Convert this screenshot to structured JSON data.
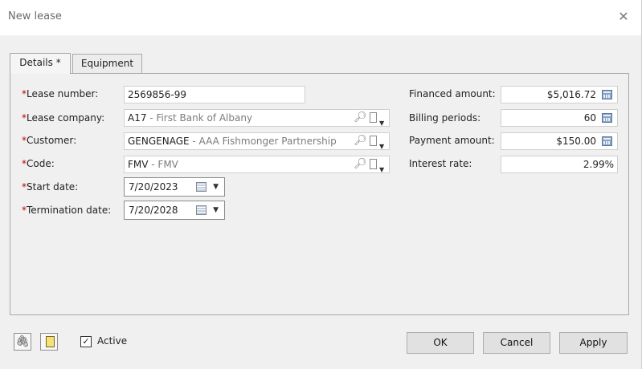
{
  "window": {
    "title": "New lease",
    "close_glyph": "✕"
  },
  "tabs": [
    {
      "label": "Details *",
      "active": true
    },
    {
      "label": "Equipment",
      "active": false
    }
  ],
  "form": {
    "required_marker": "*",
    "lease_number": {
      "label": "Lease number:",
      "value": "2569856-99"
    },
    "lease_company": {
      "label": "Lease company:",
      "code": "A17",
      "desc": " - First Bank of Albany"
    },
    "customer": {
      "label": "Customer:",
      "code": "GENGENAGE",
      "desc": " - AAA Fishmonger Partnership"
    },
    "code": {
      "label": "Code:",
      "code": "FMV",
      "desc": " - FMV"
    },
    "start_date": {
      "label": "Start date:",
      "value": "7/20/2023"
    },
    "termination_date": {
      "label": "Termination date:",
      "value": "7/20/2028"
    },
    "financed_amount": {
      "label": "Financed amount:",
      "value": "$5,016.72"
    },
    "billing_periods": {
      "label": "Billing periods:",
      "value": "60"
    },
    "payment_amount": {
      "label": "Payment amount:",
      "value": "$150.00"
    },
    "interest_rate": {
      "label": "Interest rate:",
      "value": "2.99%"
    }
  },
  "icons": {
    "lookup": "magnifier-icon",
    "menu": "page-menu-icon",
    "calculator": "calculator-icon",
    "calendar": "calendar-icon",
    "attachment": "paperclip-icon",
    "document": "document-icon"
  },
  "footer": {
    "active_checked": true,
    "active_label": "Active",
    "check_glyph": "✓",
    "ok_label": "OK",
    "cancel_label": "Cancel",
    "apply_label": "Apply"
  },
  "colors": {
    "required": "#c00000",
    "dialog_bg": "#f0f0f0"
  }
}
